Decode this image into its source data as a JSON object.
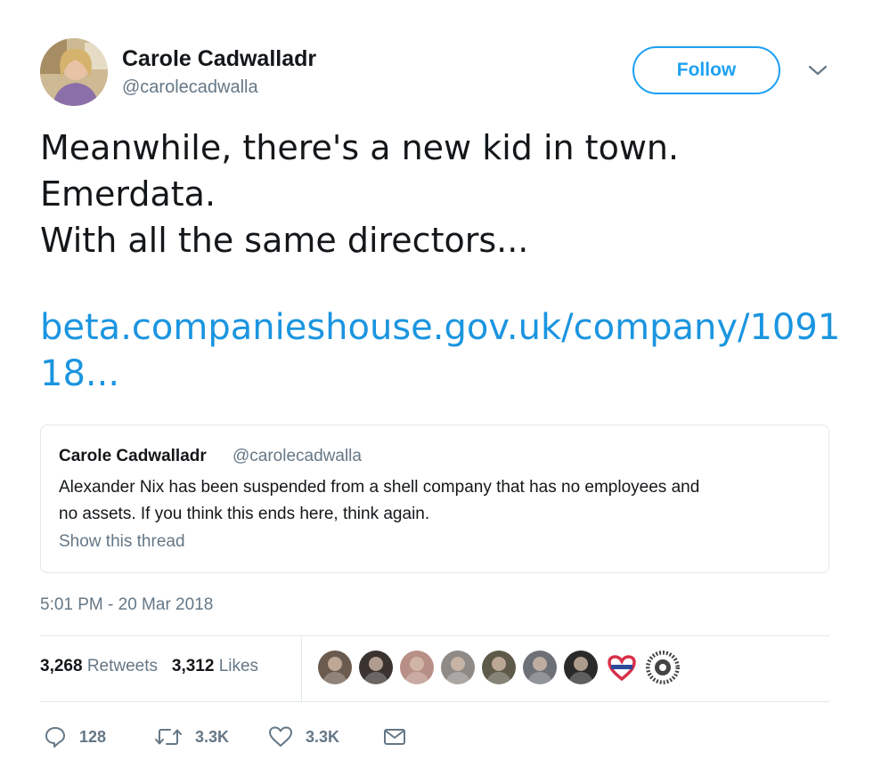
{
  "author": {
    "name": "Carole Cadwalladr",
    "handle": "@carolecadwalla"
  },
  "follow_label": "Follow",
  "tweet": {
    "lines": [
      "Meanwhile, there's a new kid in town.",
      "Emerdata.",
      "With all the same directors..."
    ],
    "link_lines": [
      "beta.companieshouse.gov.uk/company/1091",
      "18..."
    ]
  },
  "quoted": {
    "name": "Carole Cadwalladr",
    "handle": "@carolecadwalla",
    "text_lines": [
      "Alexander Nix has been suspended from a shell company that has no employees and",
      "no assets. If you think this ends here, think again."
    ],
    "thread_link": "Show this thread"
  },
  "timestamp": "5:01 PM - 20 Mar 2018",
  "stats": {
    "retweets_count": "3,268",
    "retweets_label": "Retweets",
    "likes_count": "3,312",
    "likes_label": "Likes"
  },
  "liker_avatars": [
    {
      "name": "liker-avatar-1",
      "color": "#6b5a4e"
    },
    {
      "name": "liker-avatar-2",
      "color": "#3a3330"
    },
    {
      "name": "liker-avatar-3",
      "color": "#b88f86"
    },
    {
      "name": "liker-avatar-4",
      "color": "#8f8a86"
    },
    {
      "name": "liker-avatar-5",
      "color": "#5e5a4a"
    },
    {
      "name": "liker-avatar-6",
      "color": "#6d7077"
    },
    {
      "name": "liker-avatar-7",
      "color": "#2a2a2a"
    },
    {
      "name": "liker-avatar-8",
      "color": "#d9304a"
    },
    {
      "name": "liker-avatar-9",
      "color": "#444444"
    }
  ],
  "actions": {
    "reply_count": "128",
    "retweet_count": "3.3K",
    "like_count": "3.3K"
  },
  "colors": {
    "accent": "#1da1f2",
    "link": "#1b95e0",
    "secondary_text": "#657786",
    "border": "#e1e8ed"
  },
  "icons": [
    "reply-icon",
    "retweet-icon",
    "heart-icon",
    "message-icon",
    "chevron-down-icon"
  ]
}
